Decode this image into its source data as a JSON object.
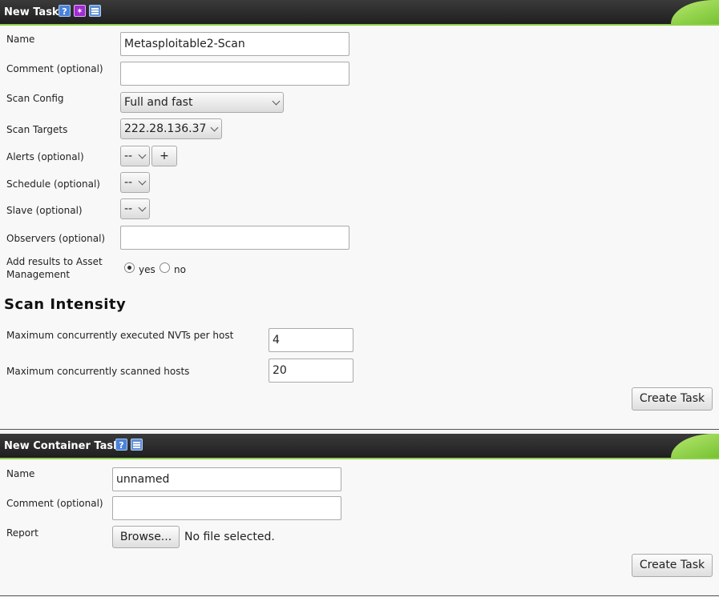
{
  "new_task": {
    "title": "New Task",
    "fields": {
      "name": {
        "label": "Name",
        "value": "Metasploitable2-Scan"
      },
      "comment": {
        "label": "Comment (optional)",
        "value": ""
      },
      "scan_config": {
        "label": "Scan Config",
        "selected": "Full and fast"
      },
      "scan_targets": {
        "label": "Scan Targets",
        "selected": "222.28.136.37"
      },
      "alerts": {
        "label": "Alerts (optional)",
        "selected": "--",
        "add_label": "+"
      },
      "schedule": {
        "label": "Schedule (optional)",
        "selected": "--"
      },
      "slave": {
        "label": "Slave (optional)",
        "selected": "--"
      },
      "observers": {
        "label": "Observers (optional)",
        "value": ""
      },
      "asset_mgmt": {
        "label_line1": "Add results to Asset",
        "label_line2": "Management",
        "yes_label": "yes",
        "no_label": "no",
        "selected": "yes"
      }
    },
    "scan_intensity": {
      "heading": "Scan Intensity",
      "max_nvts": {
        "label": "Maximum concurrently executed NVTs per host",
        "value": "4"
      },
      "max_hosts": {
        "label": "Maximum concurrently scanned hosts",
        "value": "20"
      }
    },
    "create_label": "Create Task"
  },
  "container_task": {
    "title": "New Container Task",
    "name": {
      "label": "Name",
      "value": "unnamed"
    },
    "comment": {
      "label": "Comment (optional)",
      "value": ""
    },
    "report": {
      "label": "Report",
      "browse_label": "Browse...",
      "status": "No file selected."
    },
    "create_label": "Create Task"
  },
  "colors": {
    "accent_green": "#8fd14a",
    "titlebar": "#2a2a2a"
  }
}
